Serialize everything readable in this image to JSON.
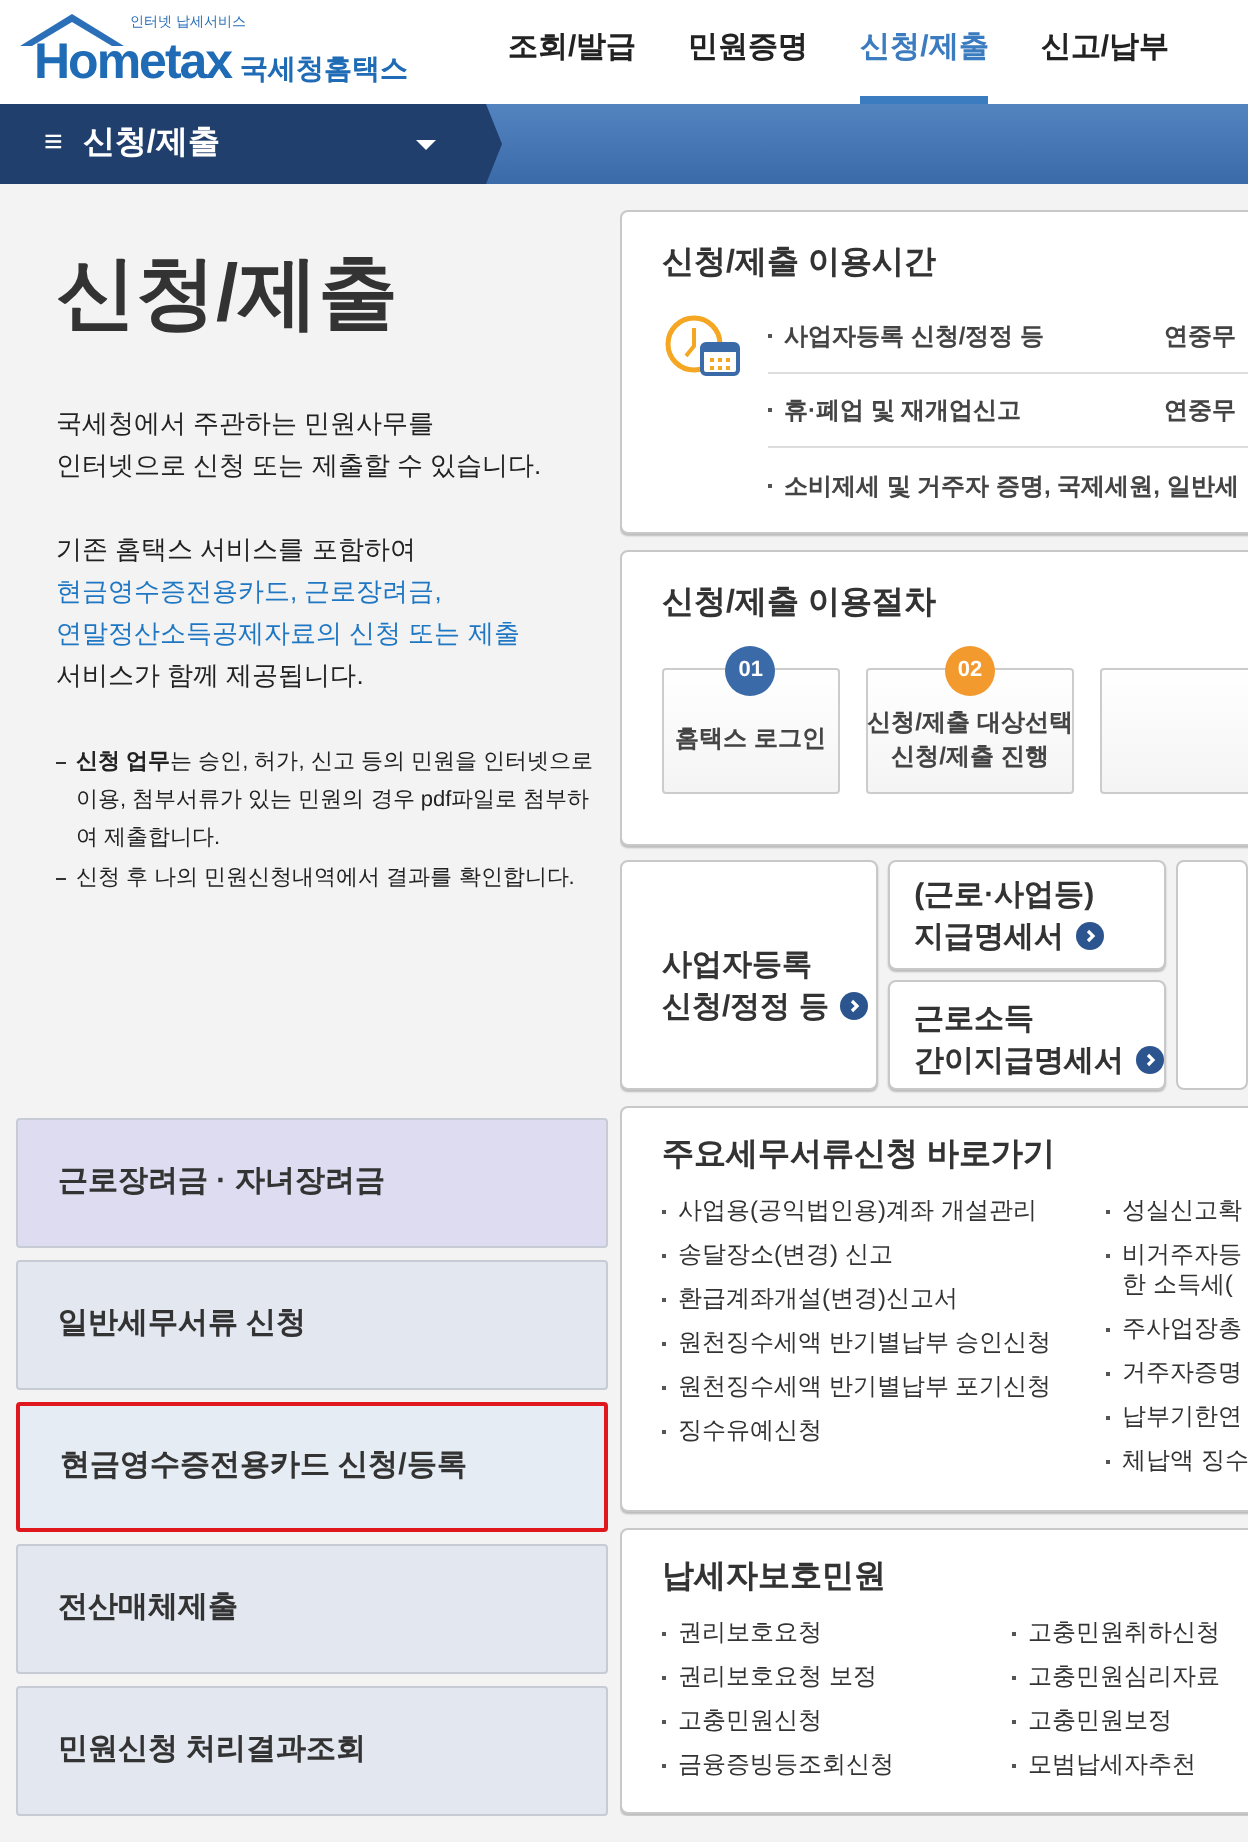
{
  "header": {
    "logo": {
      "tagline": "인터넷 납세서비스",
      "brand": "Hometax",
      "agency": "국세청홈택스"
    },
    "nav": [
      {
        "label": "조회/발급",
        "selected": false
      },
      {
        "label": "민원증명",
        "selected": false
      },
      {
        "label": "신청/제출",
        "selected": true
      },
      {
        "label": "신고/납부",
        "selected": false
      }
    ]
  },
  "breadcrumb": {
    "menu_icon": "≡",
    "label": "신청/제출"
  },
  "intro": {
    "title": "신청/제출",
    "paragraphs": [
      [
        "국세청에서 주관하는 민원사무를",
        "인터넷으로 신청 또는 제출할 수 있습니다."
      ],
      [
        "기존 홈택스 서비스를 포함하여"
      ]
    ],
    "highlight_lines": [
      "현금영수증전용카드, 근로장려금,",
      "연말정산소득공제자료의 신청 또는 제출"
    ],
    "closing": "서비스가 함께 제공됩니다.",
    "notes": [
      "**신청 업무**는 승인, 허가, 신고 등의 민원을 인터넷으로 이용, 첨부서류가 있는 민원의 경우 pdf파일로 첨부하여 제출합니다.",
      "신청 후 나의 민원신청내역에서 결과를 확인합니다."
    ]
  },
  "side_menu": [
    {
      "label": "근로장려금 · 자녀장려금",
      "selected": false,
      "color": "#dddcf1"
    },
    {
      "label": "일반세무서류 신청",
      "selected": false,
      "color": "#e3e7f0"
    },
    {
      "label": "현금영수증전용카드 신청/등록",
      "selected": true,
      "color": "#e6ecf3"
    },
    {
      "label": "전산매체제출",
      "selected": false,
      "color": "#e3e7f0"
    },
    {
      "label": "민원신청 처리결과조회",
      "selected": false,
      "color": "#e3e7f0"
    }
  ],
  "hours": {
    "title": "신청/제출 이용시간",
    "rows": [
      {
        "item": "사업자등록 신청/정정 등",
        "time": "연중무"
      },
      {
        "item": "휴·폐업 및 재개업신고",
        "time": "연중무"
      },
      {
        "item": "소비제세 및 거주자 증명, 국제세원, 일반세"
      }
    ]
  },
  "procedure": {
    "title": "신청/제출 이용절차",
    "steps": [
      {
        "number": "01",
        "lines": [
          "홈택스 로그인"
        ],
        "color": "#3a6aa8"
      },
      {
        "number": "02",
        "lines": [
          "신청/제출 대상선택",
          "신청/제출 진행"
        ],
        "color": "#f29a2e"
      },
      {
        "kind": "blank"
      }
    ]
  },
  "quick_tiles": [
    {
      "lines": [
        "사업자등록",
        "신청/정정 등"
      ]
    },
    {
      "lines": [
        "(근로·사업등)",
        "지급명세서"
      ]
    },
    {
      "lines": [
        "근로소득",
        "간이지급명세서"
      ]
    }
  ],
  "shortcuts": {
    "title": "주요세무서류신청 바로가기",
    "column_1": [
      "사업용(공익법인용)계좌 개설관리",
      "송달장소(변경) 신고",
      "환급계좌개설(변경)신고서",
      "원천징수세액 반기별납부 승인신청",
      "원천징수세액 반기별납부 포기신청",
      "징수유예신청"
    ],
    "column_2": [
      [
        "성실신고확"
      ],
      [
        "비거주자등",
        "한 소득세("
      ],
      [
        "주사업장총"
      ],
      [
        "거주자증명"
      ],
      [
        "납부기한연"
      ],
      [
        "체납액 징수"
      ]
    ]
  },
  "protection": {
    "title": "납세자보호민원",
    "column_1": [
      "권리보호요청",
      "권리보호요청 보정",
      "고충민원신청",
      "금융증빙등조회신청"
    ],
    "column_2": [
      "고충민원취하신청",
      "고충민원심리자료",
      "고충민원보정",
      "모범납세자추천"
    ]
  }
}
